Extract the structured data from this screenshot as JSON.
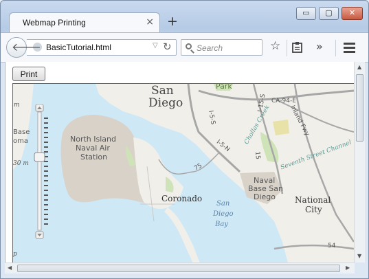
{
  "tab": {
    "title": "Webmap Printing",
    "close": "×",
    "new_tab": "+"
  },
  "window_controls": {
    "minimize": "▭",
    "maximize": "▢",
    "close": "✕"
  },
  "toolbar": {
    "url": "BasicTutorial.html",
    "search_placeholder": "Search",
    "dropdown_glyph": "▽",
    "reload_glyph": "↻"
  },
  "page": {
    "print_label": "Print"
  },
  "map": {
    "labels": {
      "san_diego_1": "San",
      "san_diego_2": "Diego",
      "park": "Park",
      "north_island_1": "North Island",
      "north_island_2": "Naval Air",
      "north_island_3": "Station",
      "coronado": "Coronado",
      "bay_1": "San",
      "bay_2": "Diego",
      "bay_3": "Bay",
      "naval_base_1": "Naval",
      "naval_base_2": "Base San",
      "naval_base_3": "Diego",
      "national_city_1": "National",
      "national_city_2": "City",
      "chollas_creek": "Chollas Creek",
      "seventh_street": "Seventh Street Channel",
      "inland_fwy": "Inland Fwy",
      "i5s": "I-5-S",
      "i5n": "I-5-N",
      "i15s": "I-15-S",
      "ca94e": "CA-94-E",
      "i15": "15",
      "r75": "75",
      "r54": "54",
      "base": "Base",
      "coma": "oma",
      "left_m": "m",
      "thirty_m": "30 m",
      "cut_p": "p"
    }
  },
  "colors": {
    "water": "#cfe8f5",
    "land": "#f1efe9",
    "military": "#d8d2c8",
    "park": "#cfe3b8",
    "road": "#a7a7a7"
  }
}
